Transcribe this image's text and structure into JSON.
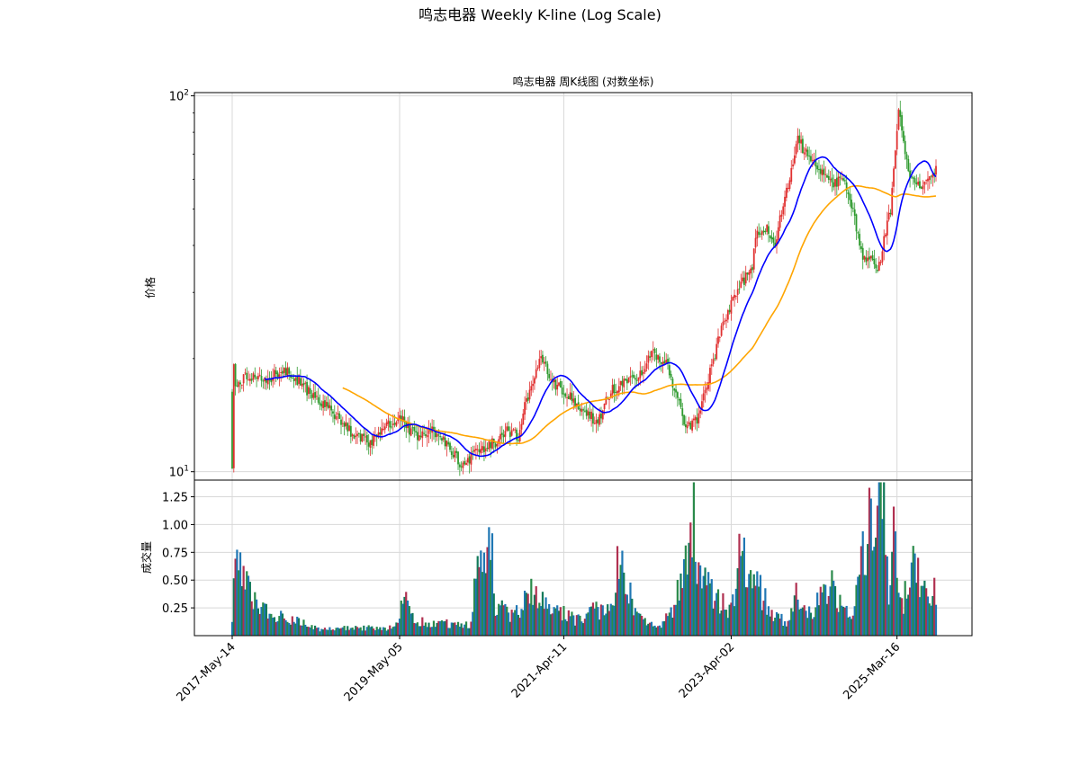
{
  "figure": {
    "suptitle": "鸣志电器 Weekly K-line (Log Scale)",
    "price_title": "鸣志电器 周K线图 (对数坐标)",
    "price_ylabel": "价格",
    "volume_ylabel": "成交量"
  },
  "colors": {
    "up": "#e03030",
    "down": "#2e9a2e",
    "ma_short": "#0000ff",
    "ma_long": "#ffa500",
    "vol_palette": [
      "#1f77b4",
      "#127a5a",
      "#b03050",
      "#1f77b4",
      "#2a8a4a"
    ],
    "grid": "#d8d8d8"
  },
  "chart_data": [
    {
      "type": "candlestick",
      "title": "鸣志电器 周K线图 (对数坐标)",
      "ylabel": "价格",
      "yscale": "log",
      "ylim": [
        9.5,
        102
      ],
      "yticks": [
        "10^1",
        "10^2"
      ],
      "xlim": [
        "2017-05-14",
        "2025-08-31"
      ],
      "xticks": [
        "2017-May-14",
        "2019-May-05",
        "2021-Apr-11",
        "2023-Apr-02",
        "2025-Mar-16"
      ],
      "grid": true,
      "anchors": {
        "dates": [
          "2017-05-14",
          "2017-05-21",
          "2017-05-28",
          "2017-07-09",
          "2017-10-01",
          "2017-12-31",
          "2018-04-01",
          "2018-07-01",
          "2018-10-07",
          "2018-12-30",
          "2019-03-03",
          "2019-05-05",
          "2019-07-07",
          "2019-10-06",
          "2020-01-05",
          "2020-02-02",
          "2020-04-05",
          "2020-06-28",
          "2020-08-02",
          "2020-09-27",
          "2020-12-27",
          "2021-03-07",
          "2021-06-27",
          "2021-09-05",
          "2021-10-31",
          "2021-12-05",
          "2022-03-06",
          "2022-04-24",
          "2022-06-26",
          "2022-08-21",
          "2022-09-18",
          "2022-11-13",
          "2023-01-08",
          "2023-02-26",
          "2023-04-23",
          "2023-07-02",
          "2023-07-16",
          "2023-08-27",
          "2023-10-08",
          "2023-12-10",
          "2024-01-14",
          "2024-02-04",
          "2024-04-07",
          "2024-06-02",
          "2024-08-04",
          "2024-10-13",
          "2024-12-29",
          "2025-02-16",
          "2025-03-23",
          "2025-05-04",
          "2025-06-29",
          "2025-08-31"
        ],
        "close": [
          10.2,
          19.5,
          16.5,
          18.0,
          17.5,
          18.7,
          16.5,
          14.8,
          12.8,
          11.8,
          13.2,
          14.0,
          12.5,
          12.8,
          11.0,
          10.3,
          11.5,
          12.0,
          13.0,
          12.5,
          20.0,
          17.0,
          14.8,
          13.5,
          16.5,
          17.0,
          18.0,
          21.0,
          19.5,
          15.0,
          13.0,
          14.0,
          19.0,
          25.0,
          30.0,
          35.0,
          42.0,
          45.0,
          40.0,
          60.0,
          78.0,
          72.0,
          65.0,
          58.0,
          60.0,
          38.0,
          35.0,
          50.0,
          90.0,
          62.0,
          56.0,
          63.0
        ]
      },
      "series": [
        {
          "name": "",
          "kind": "moving-average",
          "color": "#0000ff",
          "start": "2017-10-01"
        },
        {
          "name": "",
          "kind": "moving-average",
          "color": "#ffa500",
          "start": "2018-09-02"
        }
      ]
    },
    {
      "type": "bar",
      "ylabel": "成交量",
      "ylim": [
        0,
        1.4
      ],
      "yticks": [
        "0.25",
        "0.50",
        "0.75",
        "1.00",
        "1.25"
      ],
      "grid": true,
      "anchors": {
        "dates": [
          "2017-05-14",
          "2017-05-21",
          "2017-06-11",
          "2017-08-06",
          "2017-10-01",
          "2017-12-31",
          "2018-06-03",
          "2018-12-02",
          "2019-03-03",
          "2019-04-14",
          "2019-05-26",
          "2019-07-07",
          "2019-12-01",
          "2020-03-01",
          "2020-04-12",
          "2020-06-07",
          "2020-06-21",
          "2020-09-06",
          "2020-12-06",
          "2021-02-21",
          "2021-03-14",
          "2021-06-06",
          "2021-07-18",
          "2021-11-14",
          "2021-12-05",
          "2022-02-13",
          "2022-06-05",
          "2022-07-31",
          "2022-10-16",
          "2022-10-23",
          "2022-10-30",
          "2023-01-08",
          "2023-03-05",
          "2023-04-02",
          "2023-05-07",
          "2023-07-09",
          "2023-10-01",
          "2023-12-03",
          "2024-01-07",
          "2024-03-10",
          "2024-06-02",
          "2024-07-14",
          "2024-09-01",
          "2024-10-06",
          "2024-10-20",
          "2024-11-24",
          "2025-01-12",
          "2025-02-09",
          "2025-03-02",
          "2025-04-13",
          "2025-05-18",
          "2025-08-03",
          "2025-08-31"
        ],
        "volume": [
          0.2,
          0.45,
          0.94,
          0.35,
          0.25,
          0.18,
          0.06,
          0.08,
          0.06,
          0.1,
          0.35,
          0.15,
          0.12,
          0.1,
          0.84,
          0.91,
          0.3,
          0.2,
          0.45,
          0.2,
          0.25,
          0.15,
          0.22,
          0.3,
          0.88,
          0.2,
          0.1,
          0.3,
          0.97,
          1.22,
          0.55,
          0.45,
          0.3,
          0.25,
          0.81,
          0.55,
          0.22,
          0.12,
          0.4,
          0.2,
          0.55,
          0.3,
          0.2,
          0.7,
          0.8,
          1.18,
          1.35,
          0.5,
          0.95,
          0.35,
          0.83,
          0.3,
          0.48
        ]
      }
    }
  ]
}
